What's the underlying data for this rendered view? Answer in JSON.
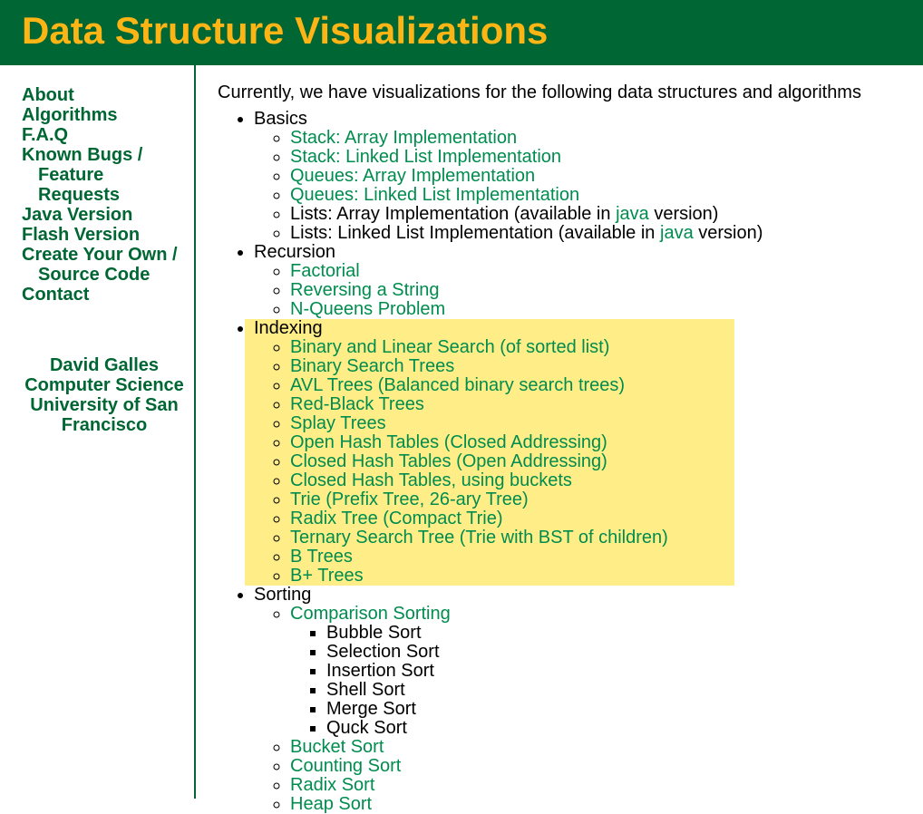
{
  "header": {
    "title": "Data Structure Visualizations"
  },
  "sidebar": {
    "items": [
      {
        "label": "About",
        "indent": false
      },
      {
        "label": "Algorithms",
        "indent": false
      },
      {
        "label": "F.A.Q",
        "indent": false
      },
      {
        "label": "Known Bugs /",
        "indent": false
      },
      {
        "label": "Feature Requests",
        "indent": true
      },
      {
        "label": "Java Version",
        "indent": false
      },
      {
        "label": "Flash Version",
        "indent": false
      },
      {
        "label": "Create Your Own /",
        "indent": false
      },
      {
        "label": "Source Code",
        "indent": true
      },
      {
        "label": "Contact",
        "indent": false
      }
    ],
    "credits": [
      "David Galles",
      "Computer Science",
      "University of San Francisco"
    ]
  },
  "main": {
    "intro": "Currently, we have visualizations for the following data structures and algorithms",
    "sections": [
      {
        "label": "Basics",
        "highlight": false,
        "items": [
          {
            "type": "link",
            "text": "Stack: Array Implementation"
          },
          {
            "type": "link",
            "text": "Stack: Linked List Implementation"
          },
          {
            "type": "link",
            "text": "Queues: Array Implementation"
          },
          {
            "type": "link",
            "text": "Queues: Linked List Implementation"
          },
          {
            "type": "mixed",
            "pre": "Lists: Array Implementation (available in ",
            "link": "java",
            "post": " version)"
          },
          {
            "type": "mixed",
            "pre": "Lists: Linked List Implementation (available in ",
            "link": "java",
            "post": " version)"
          }
        ]
      },
      {
        "label": "Recursion",
        "highlight": false,
        "items": [
          {
            "type": "link",
            "text": "Factorial"
          },
          {
            "type": "link",
            "text": "Reversing a String"
          },
          {
            "type": "link",
            "text": "N-Queens Problem"
          }
        ]
      },
      {
        "label": "Indexing",
        "highlight": true,
        "items": [
          {
            "type": "link",
            "text": "Binary and Linear Search (of sorted list)"
          },
          {
            "type": "link",
            "text": "Binary Search Trees"
          },
          {
            "type": "link",
            "text": "AVL Trees (Balanced binary search trees)"
          },
          {
            "type": "link",
            "text": "Red-Black Trees"
          },
          {
            "type": "link",
            "text": "Splay Trees"
          },
          {
            "type": "link",
            "text": "Open Hash Tables (Closed Addressing)"
          },
          {
            "type": "link",
            "text": "Closed Hash Tables (Open Addressing)"
          },
          {
            "type": "link",
            "text": "Closed Hash Tables, using buckets"
          },
          {
            "type": "link",
            "text": "Trie (Prefix Tree, 26-ary Tree)"
          },
          {
            "type": "link",
            "text": "Radix Tree (Compact Trie)"
          },
          {
            "type": "link",
            "text": "Ternary Search Tree (Trie with BST of children)"
          },
          {
            "type": "link",
            "text": "B Trees"
          },
          {
            "type": "link",
            "text": "B+ Trees"
          }
        ]
      },
      {
        "label": "Sorting",
        "highlight": false,
        "items": [
          {
            "type": "link",
            "text": "Comparison Sorting",
            "sub": [
              "Bubble Sort",
              "Selection Sort",
              "Insertion Sort",
              "Shell Sort",
              "Merge Sort",
              "Quck Sort"
            ]
          },
          {
            "type": "link",
            "text": "Bucket Sort"
          },
          {
            "type": "link",
            "text": "Counting Sort"
          },
          {
            "type": "link",
            "text": "Radix Sort"
          },
          {
            "type": "link",
            "text": "Heap Sort"
          }
        ]
      }
    ]
  }
}
